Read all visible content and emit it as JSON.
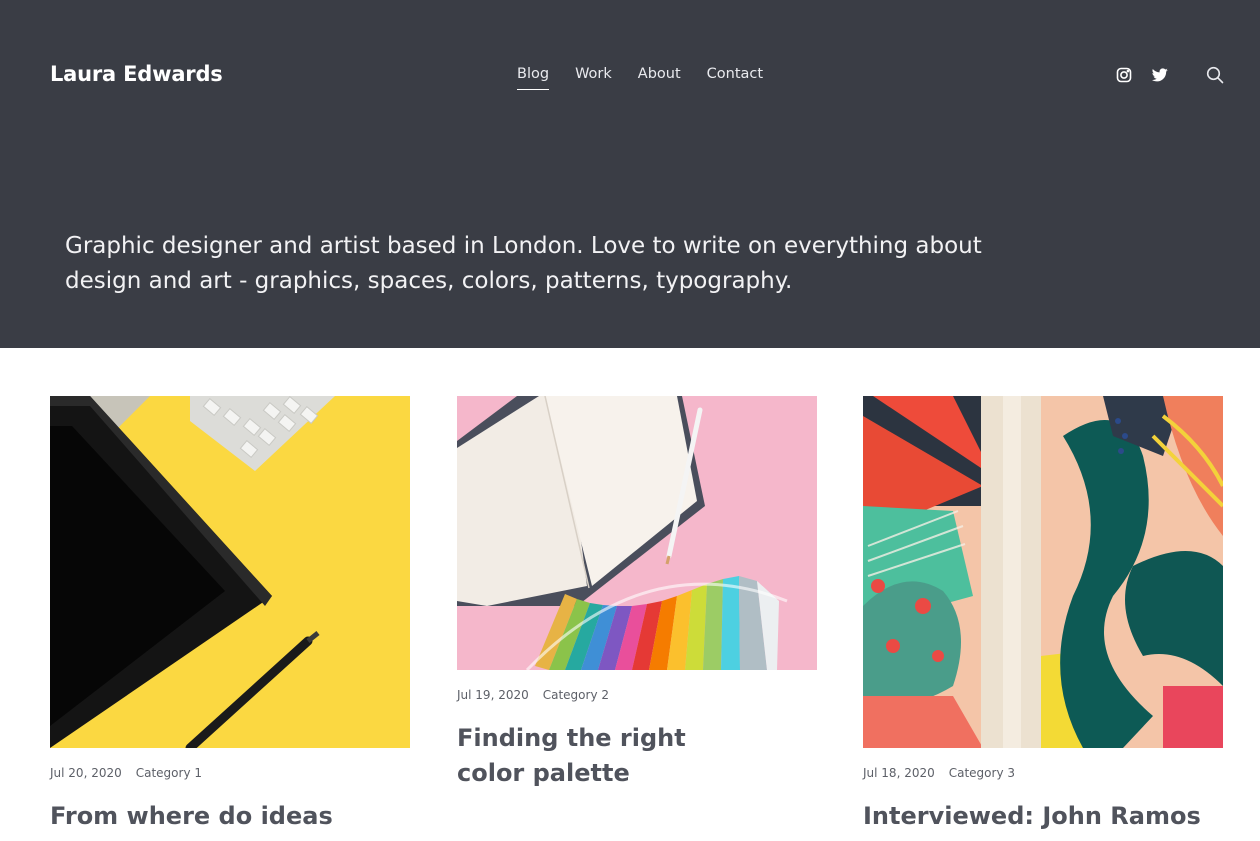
{
  "header": {
    "brand": "Laura Edwards",
    "nav": [
      {
        "label": "Blog",
        "active": true
      },
      {
        "label": "Work",
        "active": false
      },
      {
        "label": "About",
        "active": false
      },
      {
        "label": "Contact",
        "active": false
      }
    ],
    "social_icons": [
      "instagram-icon",
      "twitter-icon"
    ],
    "search_icon": "search-icon"
  },
  "hero": {
    "intro": "Graphic designer and artist based in London. Love to write on everything about design and art - graphics, spaces, colors, patterns, typography."
  },
  "posts": [
    {
      "date": "Jul 20, 2020",
      "category": "Category 1",
      "title": "From where do ideas come?",
      "image": "yellow desk with tablet and keyboard"
    },
    {
      "date": "Jul 19, 2020",
      "category": "Category 2",
      "title": "Finding the right color palette",
      "image": "notebook, pencil and color swatches on pink"
    },
    {
      "date": "Jul 18, 2020",
      "category": "Category 3",
      "title": "Interviewed: John Ramos on",
      "image": "colorful abstract painting"
    }
  ],
  "colors": {
    "hero_bg": "#3a3d45",
    "text_light": "#ffffff",
    "body_bg": "#ffffff"
  }
}
